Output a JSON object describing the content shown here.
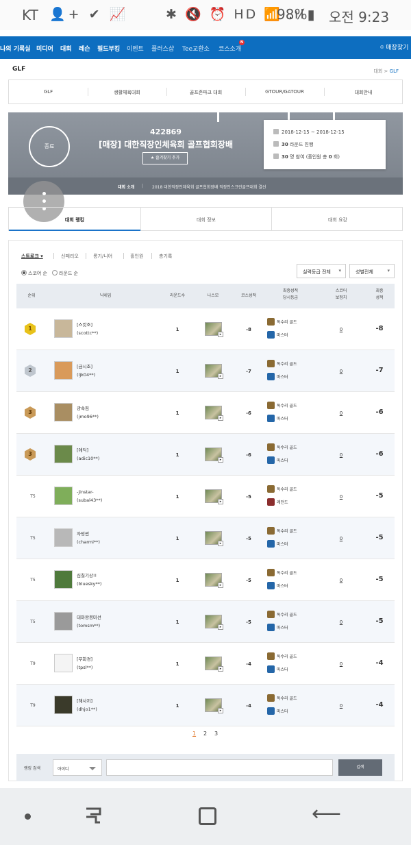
{
  "statusbar": {
    "carrier": "KT",
    "left_icons": "👤+ ✔ 📈",
    "right_icons": "✱ 🔇 ⏰ HD 📶 .ıl",
    "battery": "98%▮",
    "time": "오전 9:23"
  },
  "topnav": {
    "items": [
      "나의 기록실",
      "미디어",
      "대회",
      "레슨",
      "필드부킹",
      "이벤트",
      "플러스샵",
      "Tee교환소",
      "코스소개"
    ],
    "new_badge": "N",
    "store_label": "매장찾기"
  },
  "breadcrumb": {
    "title": "GLF",
    "path_prefix": "대회 > ",
    "path_current": "GLF"
  },
  "category_nav": [
    "GLF",
    "생활체육대회",
    "골프존파크 대회",
    "GTOUR/GATOUR",
    "대회안내"
  ],
  "hero": {
    "status": "종료",
    "id": "422869",
    "name": "[매장] 대한직장인체육회 골프협회장배",
    "fav_label": "★ 즐겨찾기 추가",
    "intro_label": "대회 소개",
    "intro_text": "2018 대한직장인체육회 골프협회장배 직장인스크린골프대회 결선"
  },
  "info": {
    "period": "2018-12-15 ~ 2018-12-15",
    "rounds_num": "30",
    "rounds_text": " 라운드 진행",
    "players_num": "30",
    "players_text": " 명 참여 (홀인원 총 ",
    "hole_in_one": "0",
    "players_end": " 회)"
  },
  "tabs": [
    "대회 랭킹",
    "대회 정보",
    "대회 요강"
  ],
  "filters": [
    "스트로크 ▾",
    "신페리오",
    "롱기/니어",
    "홀인원",
    "총기록"
  ],
  "radios": [
    "스코어 순",
    "라운드 순"
  ],
  "dropdowns": {
    "grade": "실력등급 전체",
    "gender": "성별전체"
  },
  "table_header": {
    "rank": "순위",
    "nick": "닉네임",
    "rounds": "라운드수",
    "nasmo": "나스모",
    "course": "코스성적",
    "grade_1": "최종성적",
    "grade_2": "당시등급",
    "adj_1": "스코어",
    "adj_2": "보정치",
    "final_1": "최종",
    "final_2": "성적"
  },
  "rows": [
    {
      "medal": "gold",
      "rank": "1",
      "nick1": "[스캇조]",
      "nick2": "(scottc**)",
      "rounds": "1",
      "course": "-8",
      "grade_top": "독수리 골드",
      "grade_bot": "마스터",
      "adj": "0",
      "final": "-8"
    },
    {
      "medal": "silver",
      "rank": "2",
      "nick1": "[금시조]",
      "nick2": "(ljk04**)",
      "rounds": "1",
      "course": "-7",
      "grade_top": "독수리 골드",
      "grade_bot": "마스터",
      "adj": "0",
      "final": "-7"
    },
    {
      "medal": "bronze",
      "rank": "3",
      "nick1": "광속핌",
      "nick2": "(jmo96**)",
      "rounds": "1",
      "course": "-6",
      "grade_top": "독수리 골드",
      "grade_bot": "마스터",
      "adj": "0",
      "final": "-6"
    },
    {
      "medal": "bronze",
      "rank": "3",
      "nick1": "[애딕]",
      "nick2": "(adic10**)",
      "rounds": "1",
      "course": "-6",
      "grade_top": "독수리 골드",
      "grade_bot": "마스터",
      "adj": "0",
      "final": "-6"
    },
    {
      "medal": "",
      "rank": "T5",
      "nick1": "-jinstar-",
      "nick2": "(subal43**)",
      "rounds": "1",
      "course": "-5",
      "grade_top": "독수리 골드",
      "grade_bot": "레전드",
      "adj": "0",
      "final": "-5"
    },
    {
      "medal": "",
      "rank": "T5",
      "nick1": "자밍썬",
      "nick2": "(charmi**)",
      "rounds": "1",
      "course": "-5",
      "grade_top": "독수리 골드",
      "grade_bot": "마스터",
      "adj": "0",
      "final": "-5"
    },
    {
      "medal": "",
      "rank": "T5",
      "nick1": "심칠기상!!",
      "nick2": "(bluesky**)",
      "rounds": "1",
      "course": "-5",
      "grade_top": "독수리 골드",
      "grade_bot": "마스터",
      "adj": "0",
      "final": "-5"
    },
    {
      "medal": "",
      "rank": "T5",
      "nick1": "대마왕봉미선",
      "nick2": "(tomsm**)",
      "rounds": "1",
      "course": "-5",
      "grade_top": "독수리 골드",
      "grade_bot": "마스터",
      "adj": "0",
      "final": "-5"
    },
    {
      "medal": "",
      "rank": "T9",
      "nick1": "[무화경]",
      "nick2": "(tpsl**)",
      "rounds": "1",
      "course": "-4",
      "grade_top": "독수리 골드",
      "grade_bot": "마스터",
      "adj": "0",
      "final": "-4"
    },
    {
      "medal": "",
      "rank": "T9",
      "nick1": "[해사끼]",
      "nick2": "(dhjo1**)",
      "rounds": "1",
      "course": "-4",
      "grade_top": "독수리 골드",
      "grade_bot": "마스터",
      "adj": "0",
      "final": "-4"
    }
  ],
  "pagination": [
    "1",
    "2",
    "3"
  ],
  "search": {
    "label": "랭킹 검색",
    "type": "아이디",
    "button": "검색"
  }
}
